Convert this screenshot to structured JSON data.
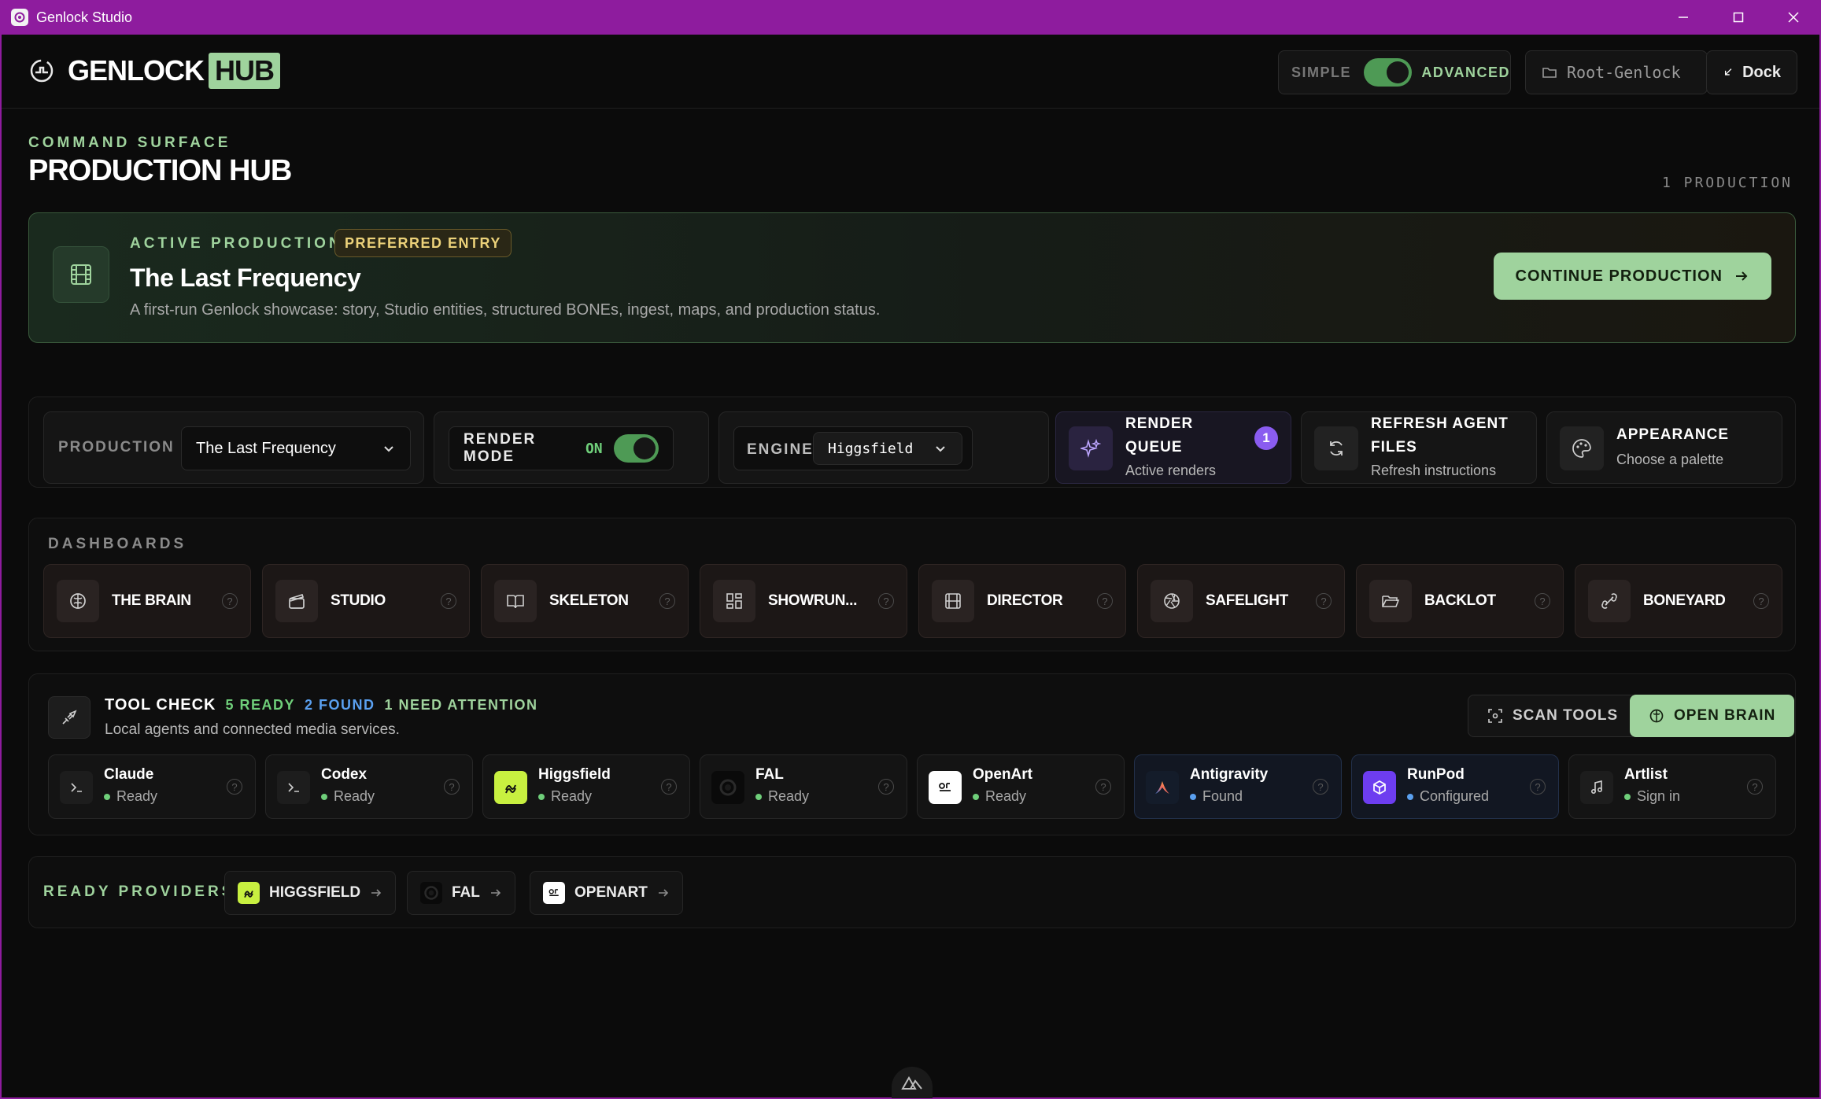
{
  "window": {
    "title": "Genlock Studio"
  },
  "header": {
    "brand_word": "GENLOCK",
    "brand_hub": "HUB",
    "mode_simple": "SIMPLE",
    "mode_advanced": "ADVANCED",
    "mode_advanced_on": true,
    "root_label": "Root-Genlock",
    "dock_label": "Dock"
  },
  "page": {
    "eyebrow": "COMMAND SURFACE",
    "title": "PRODUCTION HUB",
    "count": "1 PRODUCTION"
  },
  "active_production": {
    "label": "ACTIVE PRODUCTION",
    "badge": "PREFERRED ENTRY",
    "name": "The Last Frequency",
    "description": "A first-run Genlock showcase: story, Studio entities, structured BONEs, ingest, maps, and production status.",
    "continue_label": "CONTINUE PRODUCTION"
  },
  "controls": {
    "production_label": "PRODUCTION",
    "production_value": "The Last Frequency",
    "render_mode_label": "RENDER MODE",
    "render_mode_state": "ON",
    "engine_label": "ENGINE",
    "engine_value": "Higgsfield",
    "render_queue_title": "RENDER QUEUE",
    "render_queue_sub": "Active renders",
    "render_queue_count": "1",
    "refresh_title": "REFRESH AGENT FILES",
    "refresh_sub": "Refresh instructions",
    "appearance_title": "APPEARANCE",
    "appearance_sub": "Choose a palette"
  },
  "dashboards": {
    "heading": "DASHBOARDS",
    "items": [
      {
        "label": "THE BRAIN",
        "icon": "brain-icon"
      },
      {
        "label": "STUDIO",
        "icon": "clapperboard-icon"
      },
      {
        "label": "SKELETON",
        "icon": "book-open-icon"
      },
      {
        "label": "SHOWRUN...",
        "icon": "grid-icon"
      },
      {
        "label": "DIRECTOR",
        "icon": "film-icon"
      },
      {
        "label": "SAFELIGHT",
        "icon": "aperture-icon"
      },
      {
        "label": "BACKLOT",
        "icon": "folder-open-icon"
      },
      {
        "label": "BONEYARD",
        "icon": "bone-icon"
      }
    ],
    "help": "?"
  },
  "tool_check": {
    "title": "TOOL CHECK",
    "ready": "5 READY",
    "found": "2 FOUND",
    "attention": "1 NEED ATTENTION",
    "subtitle": "Local agents and connected media services.",
    "scan_label": "SCAN TOOLS",
    "open_brain_label": "OPEN BRAIN",
    "tools": [
      {
        "name": "Claude",
        "status": "Ready",
        "icon": "terminal-icon",
        "status_color": "#6fcf7a"
      },
      {
        "name": "Codex",
        "status": "Ready",
        "icon": "terminal-icon",
        "status_color": "#6fcf7a"
      },
      {
        "name": "Higgsfield",
        "status": "Ready",
        "icon": "higgsfield-icon",
        "status_color": "#6fcf7a"
      },
      {
        "name": "FAL",
        "status": "Ready",
        "icon": "fal-icon",
        "status_color": "#6fcf7a"
      },
      {
        "name": "OpenArt",
        "status": "Ready",
        "icon": "openart-icon",
        "status_color": "#6fcf7a"
      },
      {
        "name": "Antigravity",
        "status": "Found",
        "icon": "antigravity-icon",
        "status_color": "#5aa0f0"
      },
      {
        "name": "RunPod",
        "status": "Configured",
        "icon": "runpod-icon",
        "status_color": "#5aa0f0"
      },
      {
        "name": "Artlist",
        "status": "Sign in",
        "icon": "music-note-icon",
        "status_color": "#6fcf7a"
      }
    ]
  },
  "ready_providers": {
    "heading": "READY PROVIDERS",
    "items": [
      {
        "label": "HIGGSFIELD",
        "icon": "higgsfield-icon"
      },
      {
        "label": "FAL",
        "icon": "fal-icon"
      },
      {
        "label": "OPENART",
        "icon": "openart-icon"
      }
    ]
  },
  "colors": {
    "accent": "#9fd39d",
    "titlebar": "#8e1c9e",
    "badge": "#ecd27a",
    "found": "#5aa0f0",
    "render_count": "#8a5cf0"
  }
}
